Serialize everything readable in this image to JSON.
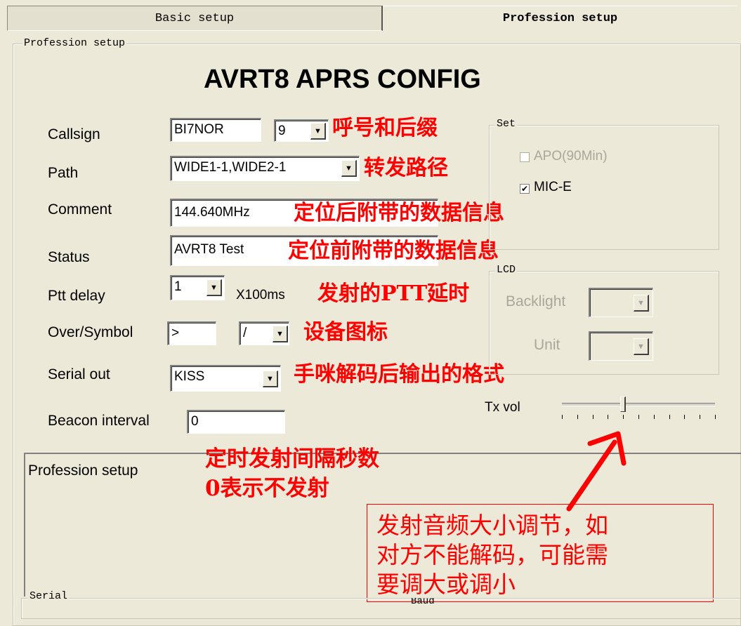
{
  "tabs": {
    "basic": "Basic setup",
    "profession": "Profession setup"
  },
  "group_profession": {
    "legend": "Profession setup"
  },
  "title": "AVRT8 APRS CONFIG",
  "labels": {
    "callsign": "Callsign",
    "path": "Path",
    "comment": "Comment",
    "status": "Status",
    "ptt_delay": "Ptt delay",
    "over_symbol": "Over/Symbol",
    "serial_out": "Serial out",
    "beacon_interval": "Beacon interval",
    "ptt_unit": "X100ms"
  },
  "values": {
    "callsign": "BI7NOR",
    "ssid": "9",
    "path": "WIDE1-1,WIDE2-1",
    "comment": "144.640MHz",
    "status": "AVRT8 Test",
    "ptt_delay": "1",
    "overlay": ">",
    "symbol": "/",
    "serial_out": "KISS",
    "beacon_interval": "0"
  },
  "set_group": {
    "legend": "Set",
    "apo_label": "APO(90Min)",
    "apo_checked": false,
    "mic_e_label": "MIC-E",
    "mic_e_checked": true
  },
  "lcd_group": {
    "legend": "LCD",
    "backlight_label": "Backlight",
    "unit_label": "Unit"
  },
  "tx_vol": {
    "label": "Tx vol",
    "level": 0.4
  },
  "info_box": {
    "text": "Profession setup"
  },
  "serial_group": {
    "legend": "Serial",
    "partial_text": "Baud"
  },
  "annotations": {
    "callsign": "呼号和后缀",
    "path": "转发路径",
    "comment": "定位后附带的数据信息",
    "status": "定位前附带的数据信息",
    "ptt": "发射的PTT延时",
    "symbol": "设备图标",
    "serial": "手咪解码后输出的格式",
    "beacon_line1": "定时发射间隔秒数",
    "beacon_line2": "0表示不发射",
    "txvol_line1": "发射音频大小调节，如",
    "txvol_line2": "对方不能解码，可能需",
    "txvol_line3": "要调大或调小"
  },
  "colors": {
    "annotation": "#ff0000",
    "background": "#ece9d8"
  }
}
